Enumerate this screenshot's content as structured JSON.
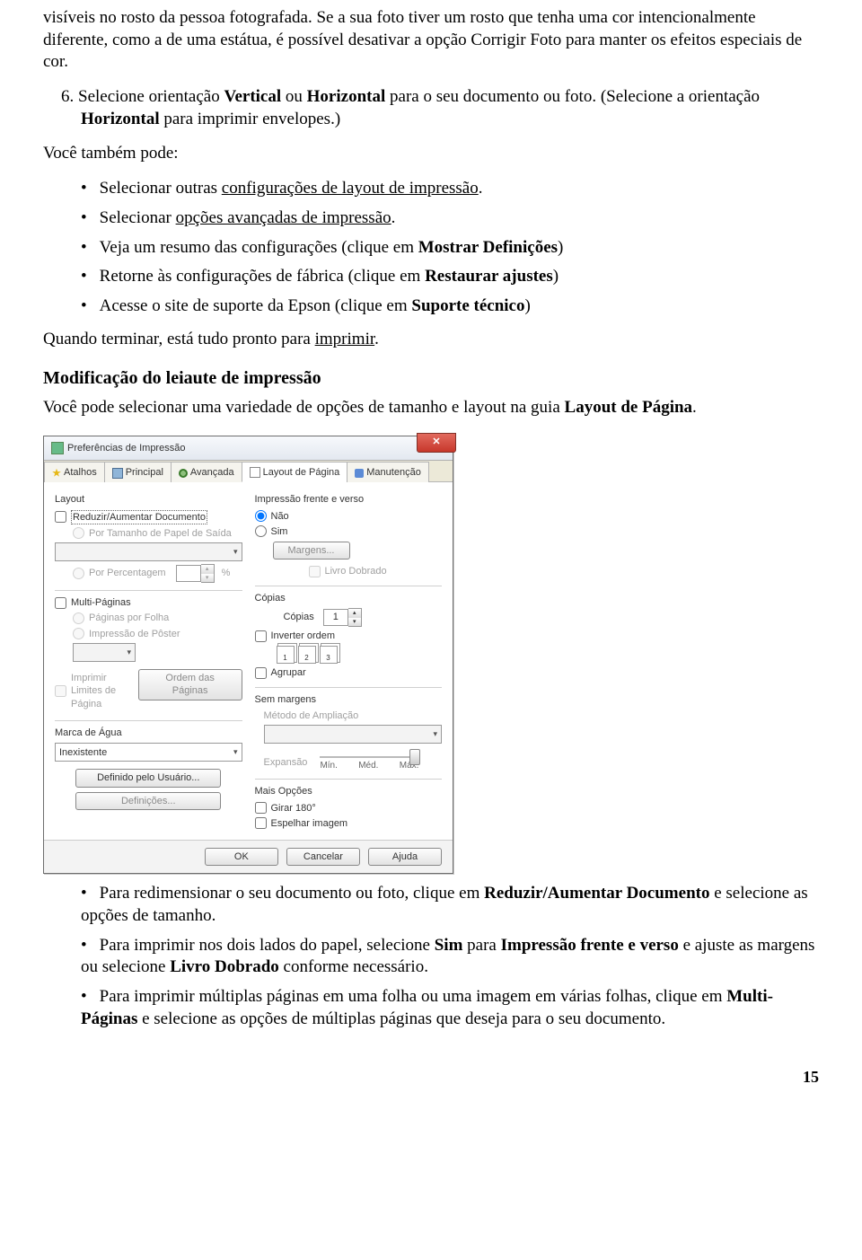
{
  "doc": {
    "para_top": "visíveis no rosto da pessoa fotografada. Se a sua foto tiver um rosto que tenha uma cor intencionalmente diferente, como a de uma estátua, é possível desativar a opção Corrigir Foto para manter os efeitos especiais de cor.",
    "step6_prefix": "6. ",
    "step6_a": "Selecione orientação ",
    "step6_b": "Vertical",
    "step6_c": " ou ",
    "step6_d": "Horizontal",
    "step6_e": " para o seu documento ou foto. (Selecione a orientação ",
    "step6_f": "Horizontal",
    "step6_g": " para imprimir envelopes.)",
    "also": "Você também pode:",
    "bul1_a": "Selecionar outras ",
    "bul1_b": "configurações de layout de impressão",
    "bul1_c": ".",
    "bul2_a": "Selecionar ",
    "bul2_b": "opções avançadas de impressão",
    "bul2_c": ".",
    "bul3_a": "Veja um resumo das configurações (clique em ",
    "bul3_b": "Mostrar Definições",
    "bul3_c": ")",
    "bul4_a": "Retorne às configurações de fábrica (clique em ",
    "bul4_b": "Restaurar ajustes",
    "bul4_c": ")",
    "bul5_a": "Acesse o site de suporte da Epson (clique em ",
    "bul5_b": "Suporte técnico",
    "bul5_c": ")",
    "done_a": "Quando terminar, está tudo pronto para ",
    "done_b": "imprimir",
    "done_c": ".",
    "sec_title": "Modificação do leiaute de impressão",
    "sec_text_a": "Você pode selecionar uma variedade de opções de tamanho e layout na guia ",
    "sec_text_b": "Layout de Página",
    "sec_text_c": ".",
    "bl1_a": "Para redimensionar o seu documento ou foto, clique em ",
    "bl1_b": "Reduzir/Aumentar Documento",
    "bl1_c": " e selecione as opções de tamanho.",
    "bl2_a": "Para imprimir nos dois lados do papel, selecione ",
    "bl2_b": "Sim",
    "bl2_c": " para ",
    "bl2_d": "Impressão frente e verso",
    "bl2_e": " e ajuste as margens ou selecione ",
    "bl2_f": "Livro Dobrado",
    "bl2_g": " conforme necessário.",
    "bl3_a": "Para imprimir múltiplas páginas em uma folha ou uma imagem em várias folhas, clique em ",
    "bl3_b": "Multi-Páginas",
    "bl3_c": " e selecione as opções de múltiplas páginas que deseja para o seu documento.",
    "page_num": "15"
  },
  "dialog": {
    "title": "Preferências de Impressão",
    "close_glyph": "✕",
    "tabs": [
      "Atalhos",
      "Principal",
      "Avançada",
      "Layout de Página",
      "Manutenção"
    ],
    "layout_label": "Layout",
    "reduce_label": "Reduzir/Aumentar Documento",
    "by_output_label": "Por Tamanho de Papel de Saída",
    "by_percent_label": "Por Percentagem",
    "percent_unit": "%",
    "multi_label": "Multi-Páginas",
    "pages_per_sheet": "Páginas por Folha",
    "poster": "Impressão de Pôster",
    "print_borders": "Imprimir Limites de Página",
    "page_order_btn": "Ordem das Páginas",
    "watermark_label": "Marca de Água",
    "watermark_value": "Inexistente",
    "user_defined_btn": "Definido pelo Usuário...",
    "definitions_btn": "Definições...",
    "duplex_label": "Impressão frente e verso",
    "duplex_no": "Não",
    "duplex_yes": "Sim",
    "margins_btn": "Margens...",
    "folded_label": "Livro Dobrado",
    "copies_grp": "Cópias",
    "copies_label": "Cópias",
    "copies_value": "1",
    "reverse_label": "Inverter ordem",
    "collate_label": "Agrupar",
    "borderless_grp": "Sem margens",
    "enlargement_label": "Método de Ampliação",
    "expansion_label": "Expansão",
    "slider_min": "Mín.",
    "slider_med": "Méd.",
    "slider_max": "Máx.",
    "more_options": "Mais Opções",
    "rotate_label": "Girar 180°",
    "mirror_label": "Espelhar imagem",
    "ok": "OK",
    "cancel": "Cancelar",
    "help": "Ajuda"
  }
}
